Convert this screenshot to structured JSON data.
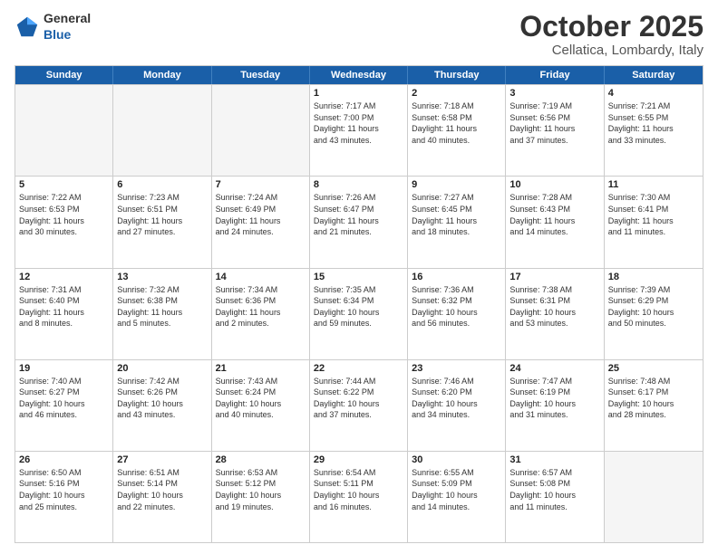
{
  "header": {
    "logo": {
      "general": "General",
      "blue": "Blue"
    },
    "month": "October 2025",
    "location": "Cellatica, Lombardy, Italy"
  },
  "calendar": {
    "days": [
      "Sunday",
      "Monday",
      "Tuesday",
      "Wednesday",
      "Thursday",
      "Friday",
      "Saturday"
    ],
    "rows": [
      [
        {
          "day": "",
          "info": "",
          "empty": true
        },
        {
          "day": "",
          "info": "",
          "empty": true
        },
        {
          "day": "",
          "info": "",
          "empty": true
        },
        {
          "day": "1",
          "info": "Sunrise: 7:17 AM\nSunset: 7:00 PM\nDaylight: 11 hours\nand 43 minutes."
        },
        {
          "day": "2",
          "info": "Sunrise: 7:18 AM\nSunset: 6:58 PM\nDaylight: 11 hours\nand 40 minutes."
        },
        {
          "day": "3",
          "info": "Sunrise: 7:19 AM\nSunset: 6:56 PM\nDaylight: 11 hours\nand 37 minutes."
        },
        {
          "day": "4",
          "info": "Sunrise: 7:21 AM\nSunset: 6:55 PM\nDaylight: 11 hours\nand 33 minutes."
        }
      ],
      [
        {
          "day": "5",
          "info": "Sunrise: 7:22 AM\nSunset: 6:53 PM\nDaylight: 11 hours\nand 30 minutes."
        },
        {
          "day": "6",
          "info": "Sunrise: 7:23 AM\nSunset: 6:51 PM\nDaylight: 11 hours\nand 27 minutes."
        },
        {
          "day": "7",
          "info": "Sunrise: 7:24 AM\nSunset: 6:49 PM\nDaylight: 11 hours\nand 24 minutes."
        },
        {
          "day": "8",
          "info": "Sunrise: 7:26 AM\nSunset: 6:47 PM\nDaylight: 11 hours\nand 21 minutes."
        },
        {
          "day": "9",
          "info": "Sunrise: 7:27 AM\nSunset: 6:45 PM\nDaylight: 11 hours\nand 18 minutes."
        },
        {
          "day": "10",
          "info": "Sunrise: 7:28 AM\nSunset: 6:43 PM\nDaylight: 11 hours\nand 14 minutes."
        },
        {
          "day": "11",
          "info": "Sunrise: 7:30 AM\nSunset: 6:41 PM\nDaylight: 11 hours\nand 11 minutes."
        }
      ],
      [
        {
          "day": "12",
          "info": "Sunrise: 7:31 AM\nSunset: 6:40 PM\nDaylight: 11 hours\nand 8 minutes."
        },
        {
          "day": "13",
          "info": "Sunrise: 7:32 AM\nSunset: 6:38 PM\nDaylight: 11 hours\nand 5 minutes."
        },
        {
          "day": "14",
          "info": "Sunrise: 7:34 AM\nSunset: 6:36 PM\nDaylight: 11 hours\nand 2 minutes."
        },
        {
          "day": "15",
          "info": "Sunrise: 7:35 AM\nSunset: 6:34 PM\nDaylight: 10 hours\nand 59 minutes."
        },
        {
          "day": "16",
          "info": "Sunrise: 7:36 AM\nSunset: 6:32 PM\nDaylight: 10 hours\nand 56 minutes."
        },
        {
          "day": "17",
          "info": "Sunrise: 7:38 AM\nSunset: 6:31 PM\nDaylight: 10 hours\nand 53 minutes."
        },
        {
          "day": "18",
          "info": "Sunrise: 7:39 AM\nSunset: 6:29 PM\nDaylight: 10 hours\nand 50 minutes."
        }
      ],
      [
        {
          "day": "19",
          "info": "Sunrise: 7:40 AM\nSunset: 6:27 PM\nDaylight: 10 hours\nand 46 minutes."
        },
        {
          "day": "20",
          "info": "Sunrise: 7:42 AM\nSunset: 6:26 PM\nDaylight: 10 hours\nand 43 minutes."
        },
        {
          "day": "21",
          "info": "Sunrise: 7:43 AM\nSunset: 6:24 PM\nDaylight: 10 hours\nand 40 minutes."
        },
        {
          "day": "22",
          "info": "Sunrise: 7:44 AM\nSunset: 6:22 PM\nDaylight: 10 hours\nand 37 minutes."
        },
        {
          "day": "23",
          "info": "Sunrise: 7:46 AM\nSunset: 6:20 PM\nDaylight: 10 hours\nand 34 minutes."
        },
        {
          "day": "24",
          "info": "Sunrise: 7:47 AM\nSunset: 6:19 PM\nDaylight: 10 hours\nand 31 minutes."
        },
        {
          "day": "25",
          "info": "Sunrise: 7:48 AM\nSunset: 6:17 PM\nDaylight: 10 hours\nand 28 minutes."
        }
      ],
      [
        {
          "day": "26",
          "info": "Sunrise: 6:50 AM\nSunset: 5:16 PM\nDaylight: 10 hours\nand 25 minutes."
        },
        {
          "day": "27",
          "info": "Sunrise: 6:51 AM\nSunset: 5:14 PM\nDaylight: 10 hours\nand 22 minutes."
        },
        {
          "day": "28",
          "info": "Sunrise: 6:53 AM\nSunset: 5:12 PM\nDaylight: 10 hours\nand 19 minutes."
        },
        {
          "day": "29",
          "info": "Sunrise: 6:54 AM\nSunset: 5:11 PM\nDaylight: 10 hours\nand 16 minutes."
        },
        {
          "day": "30",
          "info": "Sunrise: 6:55 AM\nSunset: 5:09 PM\nDaylight: 10 hours\nand 14 minutes."
        },
        {
          "day": "31",
          "info": "Sunrise: 6:57 AM\nSunset: 5:08 PM\nDaylight: 10 hours\nand 11 minutes."
        },
        {
          "day": "",
          "info": "",
          "empty": true
        }
      ]
    ]
  }
}
